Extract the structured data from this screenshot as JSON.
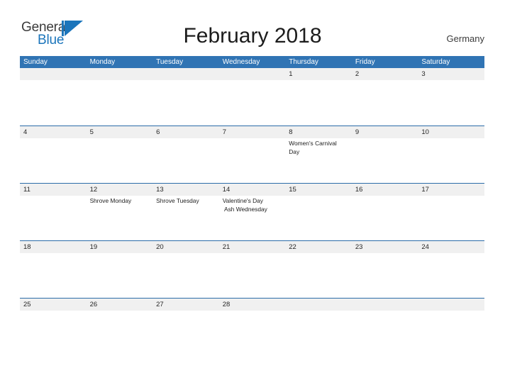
{
  "brand": {
    "name_part1": "General",
    "name_part2": "Blue",
    "mark_icon": "blue-flag-triangle-icon",
    "color_dark": "#3b3b3b",
    "color_blue": "#1b75bb"
  },
  "header": {
    "title": "February 2018",
    "country": "Germany"
  },
  "calendar": {
    "accent_header_color": "#3074b4",
    "row_separator_color": "#2b6ca8",
    "date_band_color": "#f0f0f0",
    "weekdays": [
      "Sunday",
      "Monday",
      "Tuesday",
      "Wednesday",
      "Thursday",
      "Friday",
      "Saturday"
    ],
    "weeks": [
      {
        "days": [
          {
            "date": "",
            "events": ""
          },
          {
            "date": "",
            "events": ""
          },
          {
            "date": "",
            "events": ""
          },
          {
            "date": "",
            "events": ""
          },
          {
            "date": "1",
            "events": ""
          },
          {
            "date": "2",
            "events": ""
          },
          {
            "date": "3",
            "events": ""
          }
        ]
      },
      {
        "days": [
          {
            "date": "4",
            "events": ""
          },
          {
            "date": "5",
            "events": ""
          },
          {
            "date": "6",
            "events": ""
          },
          {
            "date": "7",
            "events": ""
          },
          {
            "date": "8",
            "events": "Women's Carnival Day"
          },
          {
            "date": "9",
            "events": ""
          },
          {
            "date": "10",
            "events": ""
          }
        ]
      },
      {
        "days": [
          {
            "date": "11",
            "events": ""
          },
          {
            "date": "12",
            "events": "Shrove Monday"
          },
          {
            "date": "13",
            "events": "Shrove Tuesday"
          },
          {
            "date": "14",
            "events": "Valentine's Day\n Ash Wednesday"
          },
          {
            "date": "15",
            "events": ""
          },
          {
            "date": "16",
            "events": ""
          },
          {
            "date": "17",
            "events": ""
          }
        ]
      },
      {
        "days": [
          {
            "date": "18",
            "events": ""
          },
          {
            "date": "19",
            "events": ""
          },
          {
            "date": "20",
            "events": ""
          },
          {
            "date": "21",
            "events": ""
          },
          {
            "date": "22",
            "events": ""
          },
          {
            "date": "23",
            "events": ""
          },
          {
            "date": "24",
            "events": ""
          }
        ]
      },
      {
        "days": [
          {
            "date": "25",
            "events": ""
          },
          {
            "date": "26",
            "events": ""
          },
          {
            "date": "27",
            "events": ""
          },
          {
            "date": "28",
            "events": ""
          },
          {
            "date": "",
            "events": ""
          },
          {
            "date": "",
            "events": ""
          },
          {
            "date": "",
            "events": ""
          }
        ]
      }
    ]
  }
}
